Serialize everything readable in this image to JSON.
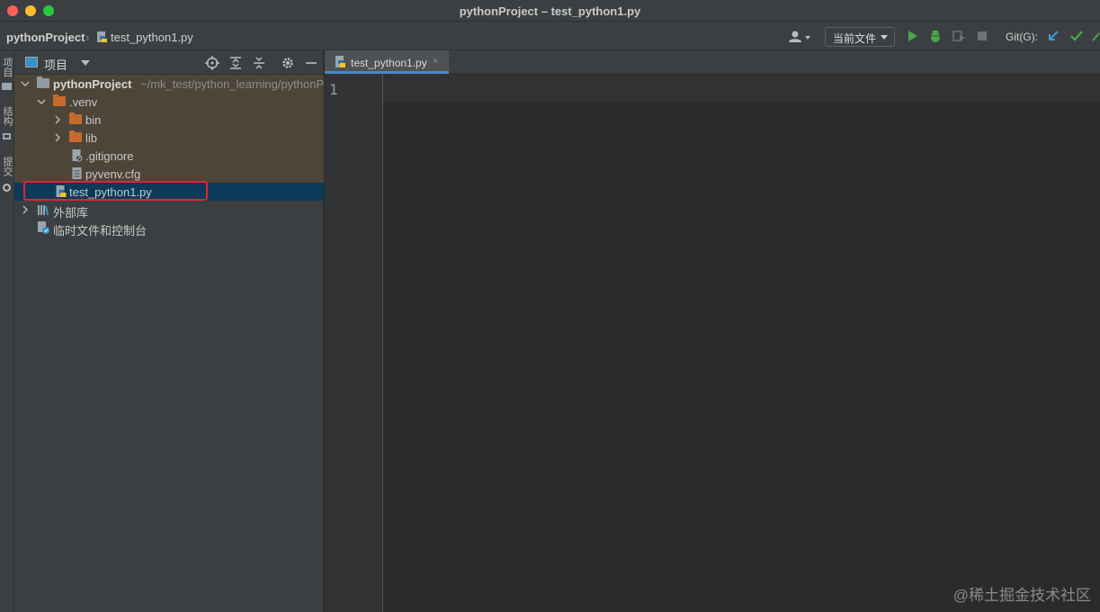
{
  "window": {
    "title": "pythonProject – test_python1.py"
  },
  "breadcrumb": {
    "project": "pythonProject",
    "separator": "›",
    "file": "test_python1.py"
  },
  "toolbar": {
    "run_config": "当前文件",
    "git_label": "Git(G):"
  },
  "left_strip": {
    "project_tab": "项目",
    "structure_tab": "结构",
    "commit_tab": "提交"
  },
  "project_panel": {
    "title": "项目",
    "tree": [
      {
        "label": "pythonProject",
        "path": "~/mk_test/python_learning/pythonProject"
      },
      {
        "label": ".venv"
      },
      {
        "label": "bin"
      },
      {
        "label": "lib"
      },
      {
        "label": ".gitignore"
      },
      {
        "label": "pyvenv.cfg"
      },
      {
        "label": "test_python1.py"
      },
      {
        "label": "外部库"
      },
      {
        "label": "临时文件和控制台"
      }
    ]
  },
  "editor": {
    "tabs": [
      {
        "label": "test_python1.py",
        "close": "×"
      }
    ],
    "line_numbers": [
      "1"
    ]
  },
  "watermark": "@稀土掘金技术社区",
  "colors": {
    "highlight": "#e0242f",
    "selection": "#0d3a58",
    "venv_bg": "#4d4538",
    "folder": "#c56a2e"
  }
}
